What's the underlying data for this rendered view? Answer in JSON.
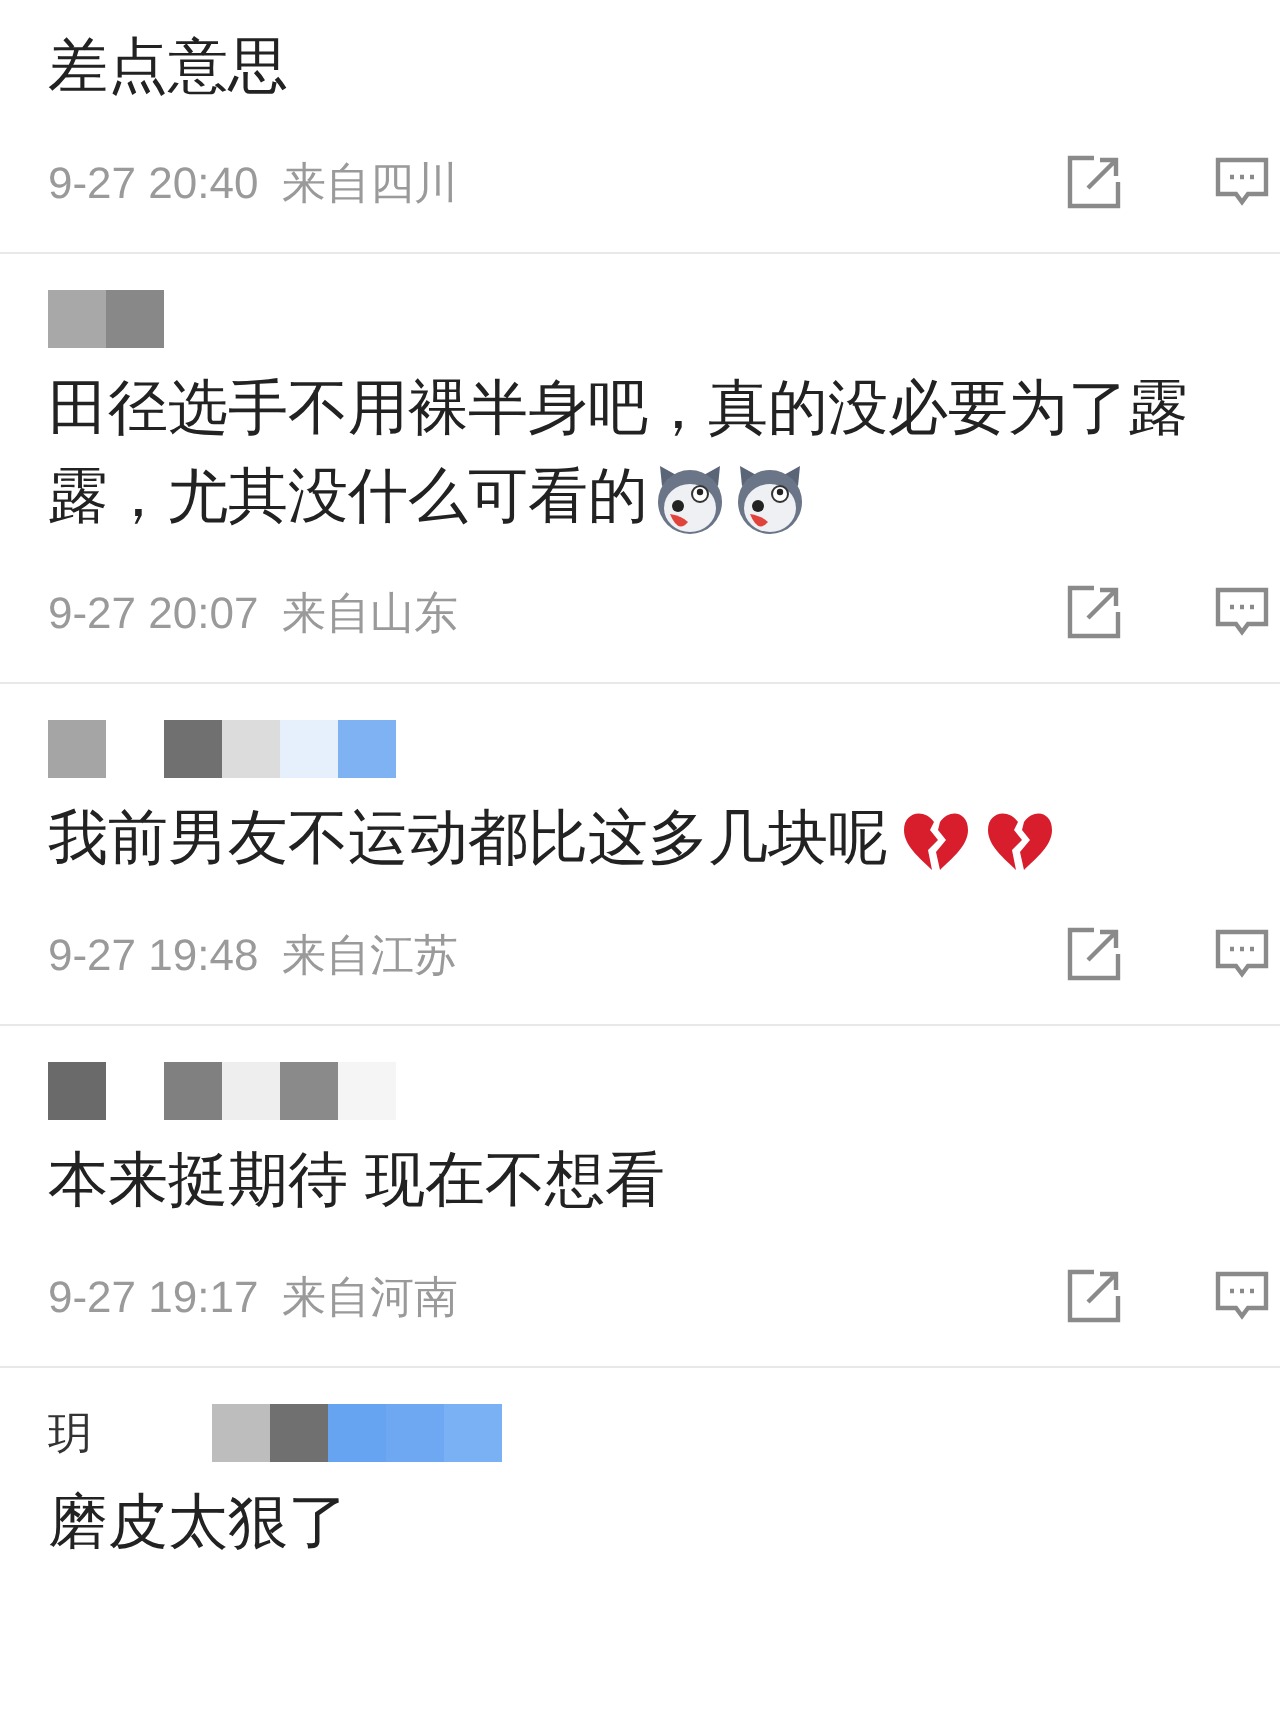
{
  "comments": [
    {
      "text": "差点意思",
      "time": "9-27 20:40",
      "location": "来自四川"
    },
    {
      "text": "田径选手不用裸半身吧，真的没必要为了露露，尤其没什么可看的",
      "emojis": [
        {
          "kind": "husky"
        },
        {
          "kind": "husky"
        }
      ],
      "time": "9-27 20:07",
      "location": "来自山东"
    },
    {
      "text": "我前男友不运动都比这多几块呢",
      "emojis": [
        {
          "kind": "broken-heart"
        },
        {
          "kind": "broken-heart"
        }
      ],
      "time": "9-27 19:48",
      "location": "来自江苏"
    },
    {
      "text": "本来挺期待 现在不想看",
      "time": "9-27 19:17",
      "location": "来自河南"
    },
    {
      "name_fragment": "玥",
      "text": "磨皮太狠了"
    }
  ]
}
